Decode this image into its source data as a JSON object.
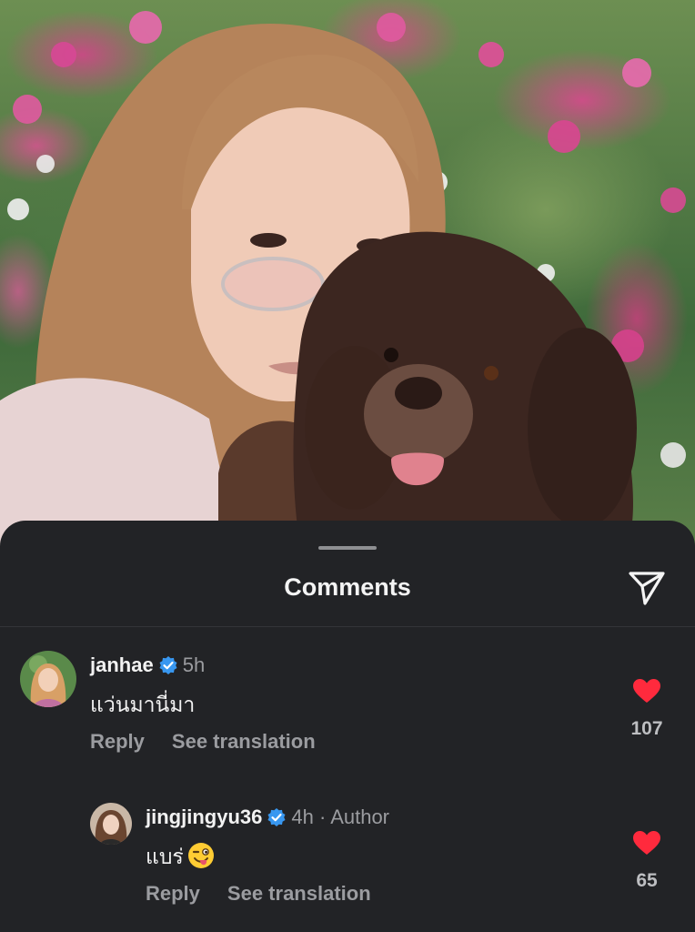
{
  "post_photo": {
    "subject": "photo of a woman with glasses holding a brown curly-haired dog in front of flowers"
  },
  "sheet": {
    "title": "Comments",
    "share_icon": "send-icon"
  },
  "comments": [
    {
      "username": "janhae",
      "verified": true,
      "time": "5h",
      "author_tag": "",
      "text": "แว่นมานี่มา",
      "reply_label": "Reply",
      "translate_label": "See translation",
      "likes": "107",
      "liked": true
    },
    {
      "username": "jingjingyu36",
      "verified": true,
      "time": "4h",
      "author_tag": "· Author",
      "text": "แบร่",
      "emoji": "winking-face-with-tongue",
      "reply_label": "Reply",
      "translate_label": "See translation",
      "likes": "65",
      "liked": true
    }
  ],
  "colors": {
    "sheet_bg": "#222326",
    "like_red": "#ff2a3d",
    "verified_blue": "#3897f0",
    "secondary_text": "#9b9ca0"
  }
}
